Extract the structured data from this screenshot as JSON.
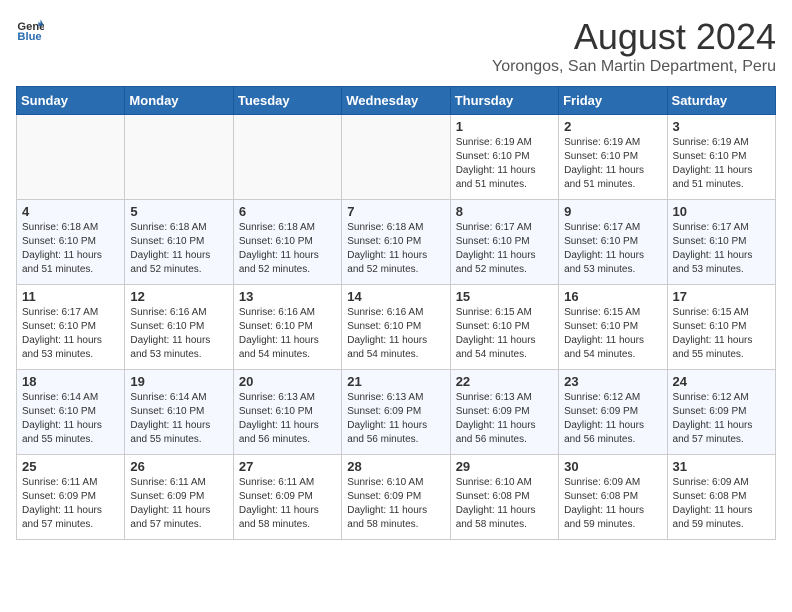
{
  "header": {
    "logo_general": "General",
    "logo_blue": "Blue",
    "title": "August 2024",
    "subtitle": "Yorongos, San Martin Department, Peru"
  },
  "calendar": {
    "days_of_week": [
      "Sunday",
      "Monday",
      "Tuesday",
      "Wednesday",
      "Thursday",
      "Friday",
      "Saturday"
    ],
    "weeks": [
      [
        {
          "day": "",
          "info": ""
        },
        {
          "day": "",
          "info": ""
        },
        {
          "day": "",
          "info": ""
        },
        {
          "day": "",
          "info": ""
        },
        {
          "day": "1",
          "info": "Sunrise: 6:19 AM\nSunset: 6:10 PM\nDaylight: 11 hours\nand 51 minutes."
        },
        {
          "day": "2",
          "info": "Sunrise: 6:19 AM\nSunset: 6:10 PM\nDaylight: 11 hours\nand 51 minutes."
        },
        {
          "day": "3",
          "info": "Sunrise: 6:19 AM\nSunset: 6:10 PM\nDaylight: 11 hours\nand 51 minutes."
        }
      ],
      [
        {
          "day": "4",
          "info": "Sunrise: 6:18 AM\nSunset: 6:10 PM\nDaylight: 11 hours\nand 51 minutes."
        },
        {
          "day": "5",
          "info": "Sunrise: 6:18 AM\nSunset: 6:10 PM\nDaylight: 11 hours\nand 52 minutes."
        },
        {
          "day": "6",
          "info": "Sunrise: 6:18 AM\nSunset: 6:10 PM\nDaylight: 11 hours\nand 52 minutes."
        },
        {
          "day": "7",
          "info": "Sunrise: 6:18 AM\nSunset: 6:10 PM\nDaylight: 11 hours\nand 52 minutes."
        },
        {
          "day": "8",
          "info": "Sunrise: 6:17 AM\nSunset: 6:10 PM\nDaylight: 11 hours\nand 52 minutes."
        },
        {
          "day": "9",
          "info": "Sunrise: 6:17 AM\nSunset: 6:10 PM\nDaylight: 11 hours\nand 53 minutes."
        },
        {
          "day": "10",
          "info": "Sunrise: 6:17 AM\nSunset: 6:10 PM\nDaylight: 11 hours\nand 53 minutes."
        }
      ],
      [
        {
          "day": "11",
          "info": "Sunrise: 6:17 AM\nSunset: 6:10 PM\nDaylight: 11 hours\nand 53 minutes."
        },
        {
          "day": "12",
          "info": "Sunrise: 6:16 AM\nSunset: 6:10 PM\nDaylight: 11 hours\nand 53 minutes."
        },
        {
          "day": "13",
          "info": "Sunrise: 6:16 AM\nSunset: 6:10 PM\nDaylight: 11 hours\nand 54 minutes."
        },
        {
          "day": "14",
          "info": "Sunrise: 6:16 AM\nSunset: 6:10 PM\nDaylight: 11 hours\nand 54 minutes."
        },
        {
          "day": "15",
          "info": "Sunrise: 6:15 AM\nSunset: 6:10 PM\nDaylight: 11 hours\nand 54 minutes."
        },
        {
          "day": "16",
          "info": "Sunrise: 6:15 AM\nSunset: 6:10 PM\nDaylight: 11 hours\nand 54 minutes."
        },
        {
          "day": "17",
          "info": "Sunrise: 6:15 AM\nSunset: 6:10 PM\nDaylight: 11 hours\nand 55 minutes."
        }
      ],
      [
        {
          "day": "18",
          "info": "Sunrise: 6:14 AM\nSunset: 6:10 PM\nDaylight: 11 hours\nand 55 minutes."
        },
        {
          "day": "19",
          "info": "Sunrise: 6:14 AM\nSunset: 6:10 PM\nDaylight: 11 hours\nand 55 minutes."
        },
        {
          "day": "20",
          "info": "Sunrise: 6:13 AM\nSunset: 6:10 PM\nDaylight: 11 hours\nand 56 minutes."
        },
        {
          "day": "21",
          "info": "Sunrise: 6:13 AM\nSunset: 6:09 PM\nDaylight: 11 hours\nand 56 minutes."
        },
        {
          "day": "22",
          "info": "Sunrise: 6:13 AM\nSunset: 6:09 PM\nDaylight: 11 hours\nand 56 minutes."
        },
        {
          "day": "23",
          "info": "Sunrise: 6:12 AM\nSunset: 6:09 PM\nDaylight: 11 hours\nand 56 minutes."
        },
        {
          "day": "24",
          "info": "Sunrise: 6:12 AM\nSunset: 6:09 PM\nDaylight: 11 hours\nand 57 minutes."
        }
      ],
      [
        {
          "day": "25",
          "info": "Sunrise: 6:11 AM\nSunset: 6:09 PM\nDaylight: 11 hours\nand 57 minutes."
        },
        {
          "day": "26",
          "info": "Sunrise: 6:11 AM\nSunset: 6:09 PM\nDaylight: 11 hours\nand 57 minutes."
        },
        {
          "day": "27",
          "info": "Sunrise: 6:11 AM\nSunset: 6:09 PM\nDaylight: 11 hours\nand 58 minutes."
        },
        {
          "day": "28",
          "info": "Sunrise: 6:10 AM\nSunset: 6:09 PM\nDaylight: 11 hours\nand 58 minutes."
        },
        {
          "day": "29",
          "info": "Sunrise: 6:10 AM\nSunset: 6:08 PM\nDaylight: 11 hours\nand 58 minutes."
        },
        {
          "day": "30",
          "info": "Sunrise: 6:09 AM\nSunset: 6:08 PM\nDaylight: 11 hours\nand 59 minutes."
        },
        {
          "day": "31",
          "info": "Sunrise: 6:09 AM\nSunset: 6:08 PM\nDaylight: 11 hours\nand 59 minutes."
        }
      ]
    ]
  }
}
